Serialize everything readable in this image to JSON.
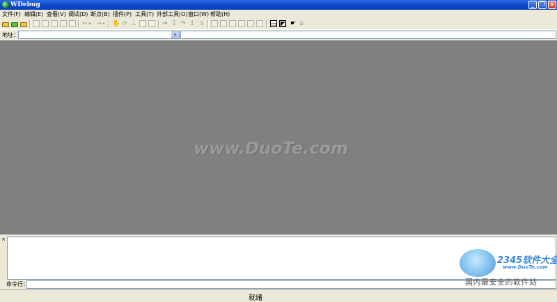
{
  "window": {
    "title": "WDebug",
    "controls": [
      "minimize-icon",
      "maximize-icon",
      "close-icon"
    ]
  },
  "menu": [
    "文件(F)",
    "编辑(E)",
    "查看(V)",
    "调试(D)",
    "断点(B)",
    "插件(P)",
    "工具(T)",
    "外部工具(O)",
    "窗口(W)",
    "帮助(H)"
  ],
  "toolbar": {
    "icons": [
      "open-folder-icon",
      "new-folder-icon",
      "open-file-icon",
      "copy-icon",
      "paste-icon",
      "back-arrow-icon",
      "forward-arrow-icon",
      "hand-icon",
      "step-icon",
      "run-icon",
      "toggle-window-icon",
      "debug-window-icon",
      "cursor-icon"
    ],
    "glyphs": {
      "back": "←",
      "back_drop": "▾",
      "forward": "→",
      "forward_drop": "▾",
      "small_drop": "⇊"
    }
  },
  "address": {
    "label": "地址：",
    "value": "",
    "dropdown_glyph": "▾"
  },
  "watermark": "www.DuoTe.com",
  "output": {
    "close_glyph": "×",
    "content": ""
  },
  "command": {
    "label": "命令行：",
    "value": ""
  },
  "status": {
    "text": "就绪"
  },
  "logo": {
    "brand": "2345软件大全",
    "url": "www.DuoTe.com",
    "slogan": "国内最安全的软件站"
  },
  "colors": {
    "titlebar": "#0a46c8",
    "chrome": "#ece9d8",
    "mdi_background": "#808080",
    "close_button": "#c3391b",
    "logo_blue": "#3a8ad6"
  }
}
